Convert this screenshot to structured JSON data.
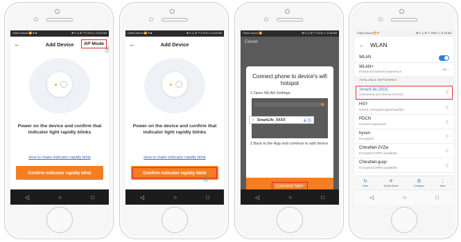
{
  "colors": {
    "accent_orange": "#f57e22",
    "highlight_red": "#e0282c",
    "link_blue": "#3a66c8",
    "wlan_blue": "#2a82d6"
  },
  "nav_icons": [
    "back-triangle-icon",
    "home-circle-icon",
    "recents-square-icon"
  ],
  "screen1": {
    "status_left": "China Unicom 📶 ✉ ■",
    "status_right": "✱ ⊙ ◎ ⚙ ⁴⁶.ıl 91% ▭ 10:40 AM",
    "title": "Add Device",
    "ap_mode_label": "AP Mode",
    "message": "Power on the device and confirm that indicator light rapidly blinks",
    "help_link": "How to make indicator rapidly blink",
    "confirm_button": "Confirm indicator rapidly blink"
  },
  "screen2": {
    "status_left": "China Unicom 📶 ✉ ■",
    "status_right": "✱ ⊙ ◎ ⚙ ⁴⁶.ıl 91% ▭ 10:43 AM",
    "title": "Add Device",
    "message": "Power on the device and confirm that indicator light rapidly blinks",
    "help_link": "How to make indicator rapidly blink",
    "confirm_button": "Confirm indicator rapidly blink"
  },
  "screen3": {
    "status_left": "China Unicom 📶",
    "status_right": "✱ ⊙ ◎ ⚙ ⁴⁶.ıl 91% ▭ 11:08 AM",
    "cancel_label": "Cancel",
    "modal_title": "Connect phone to device's wifi hotspot",
    "step1": "1.Open WLAN Settings",
    "ssid_example": "SmartLife_XXXX",
    "step2": "2.Back to the App and continue to add device",
    "connect_button": "Connect Now"
  },
  "screen4": {
    "status_left": "China Unicom 📶 ✉",
    "status_right": "✱ ⊙ ◎ ⚙ ⁴⁶.ıl 86% ▭ 11:09 AM",
    "title": "WLAN",
    "wlan_label": "WLAN",
    "wlan_plus_label": "WLAN+",
    "wlan_plus_sub": "Enhanced internet experience",
    "wlan_plus_value": "On",
    "section_header": "AVAILABLE NETWORKS",
    "networks": [
      {
        "name": "SmartLife-25DC",
        "status": "Connected (no internet access)"
      },
      {
        "name": "HSY",
        "status": "Saved, encrypted (good quality)"
      },
      {
        "name": "PDCN",
        "status": "Incorrect password"
      },
      {
        "name": "hysen",
        "status": "Encrypted"
      },
      {
        "name": "ChinaNet-2VZw",
        "status": "Encrypted (WPS available)"
      },
      {
        "name": "ChinaNet-guqv",
        "status": "Encrypted (WPS available)"
      }
    ],
    "toolbar": [
      {
        "icon": "scan-icon",
        "label": "Scan"
      },
      {
        "icon": "wlan-direct-icon",
        "label": "WLAN Direct"
      },
      {
        "icon": "configure-gear-icon",
        "label": "Configure"
      },
      {
        "icon": "more-dots-icon",
        "label": "More"
      }
    ]
  }
}
